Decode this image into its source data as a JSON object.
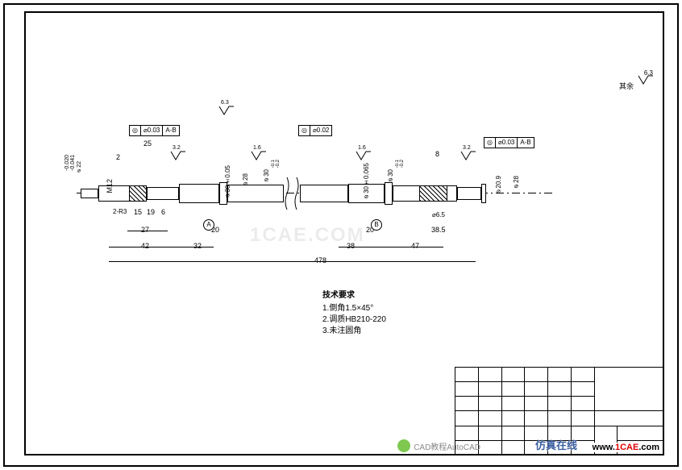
{
  "chart_data": {
    "type": "engineering_drawing",
    "part": "Shaft",
    "overall_length": 478,
    "segments_from_left": [
      {
        "feature": "threaded_end",
        "thread": "M12",
        "length": 2,
        "radius_feature": "2-R3"
      },
      {
        "feature": "step",
        "length": 25,
        "sub_lengths": [
          15,
          19,
          6
        ],
        "width_ref": 27,
        "diameter": 22,
        "diameter_tol": "-0.020/-0.041",
        "chamfer": "1.5×45°",
        "surface_finish": 3.2
      },
      {
        "feature": "journal",
        "length": 42
      },
      {
        "feature": "journal",
        "length": 32,
        "diameter": 30,
        "diameter_tol": "±0.05",
        "surface_finish": 1.6,
        "datum": "A",
        "width_ref": 20
      },
      {
        "feature": "shoulder",
        "diameter_nominal": 28
      },
      {
        "feature": "body",
        "diameter": 30,
        "diameter_tol": "-0.1/-0.2",
        "surface_finish": 6.3
      },
      {
        "feature": "break",
        "note": "long break symbol"
      },
      {
        "feature": "journal",
        "length": 38,
        "diameter": 30,
        "diameter_tol": "±0.065",
        "surface_finish": 1.6,
        "datum": "B",
        "width_ref": 20
      },
      {
        "feature": "shoulder",
        "diameter": 30,
        "diameter_tol": "-0.1/-0.2"
      },
      {
        "feature": "keyed_end",
        "length": 47,
        "sub": 38.5,
        "key_slot_dia": 6.5,
        "lead_in": 8,
        "surface_finish": 3.2
      },
      {
        "feature": "end",
        "diameter": 20.9,
        "outer_diameter": 28
      }
    ],
    "gdt": [
      {
        "symbol": "◎",
        "tol": "⌀0.03",
        "datum": "A-B",
        "applies_to": "left bearing journal"
      },
      {
        "symbol": "◎",
        "tol": "⌀0.02",
        "datum": "",
        "applies_to": "center body"
      },
      {
        "symbol": "◎",
        "tol": "⌀0.03",
        "datum": "A-B",
        "applies_to": "right end"
      }
    ],
    "general_surface_finish": 6.3,
    "technical_notes_header": "技术要求",
    "technical_notes": [
      "倒角1.5×45°",
      "调质HB210-220",
      "未注圆角"
    ]
  },
  "labels": {
    "general_finish": "6.3",
    "other_symbol": "其余",
    "gdt1_sym": "◎",
    "gdt1_tol": "⌀0.03",
    "gdt1_dat": "A-B",
    "gdt2_sym": "◎",
    "gdt2_tol": "⌀0.02",
    "gdt3_sym": "◎",
    "gdt3_tol": "⌀0.03",
    "gdt3_dat": "A-B",
    "dim_25": "25",
    "dim_2": "2",
    "dim_15": "15",
    "dim_19": "19",
    "dim_6": "6",
    "dim_27": "27",
    "dim_42": "42",
    "dim_32": "32",
    "dim_20a": "20",
    "dim_478": "478",
    "dim_38": "38",
    "dim_20b": "20",
    "dim_47": "47",
    "dim_385": "38.5",
    "dim_8": "8",
    "sf_32a": "3.2",
    "sf_16a": "1.6",
    "sf_63": "6.3",
    "sf_16b": "1.6",
    "sf_32b": "3.2",
    "m12": "M12",
    "r3": "2-R3",
    "d22": "⌀22",
    "d22_tol": "-0.020\n-0.041",
    "d30a": "⌀30±0.05",
    "d28": "⌀28",
    "d30body": "⌀30",
    "d30body_tol": "-0.1\n-0.2",
    "d30b": "⌀30±0.065",
    "d30c": "⌀30",
    "d30c_tol": "-0.1\n-0.2",
    "d65": "⌀6.5",
    "d209": "⌀20.9",
    "d28r": "⌀28",
    "datumA": "A",
    "datumB": "B",
    "tech_title": "技术要求",
    "tech1": "1.倒角1.5×45°",
    "tech2": "2.调质HB210-220",
    "tech3": "3.未注圆角",
    "watermark_center": "1CAE.COM",
    "wechat_text": "CAD教程AutoCAD",
    "brand_text": "仿真在线",
    "domain_www": "www.",
    "domain_1cae": "1CAE",
    "domain_com": ".com"
  }
}
